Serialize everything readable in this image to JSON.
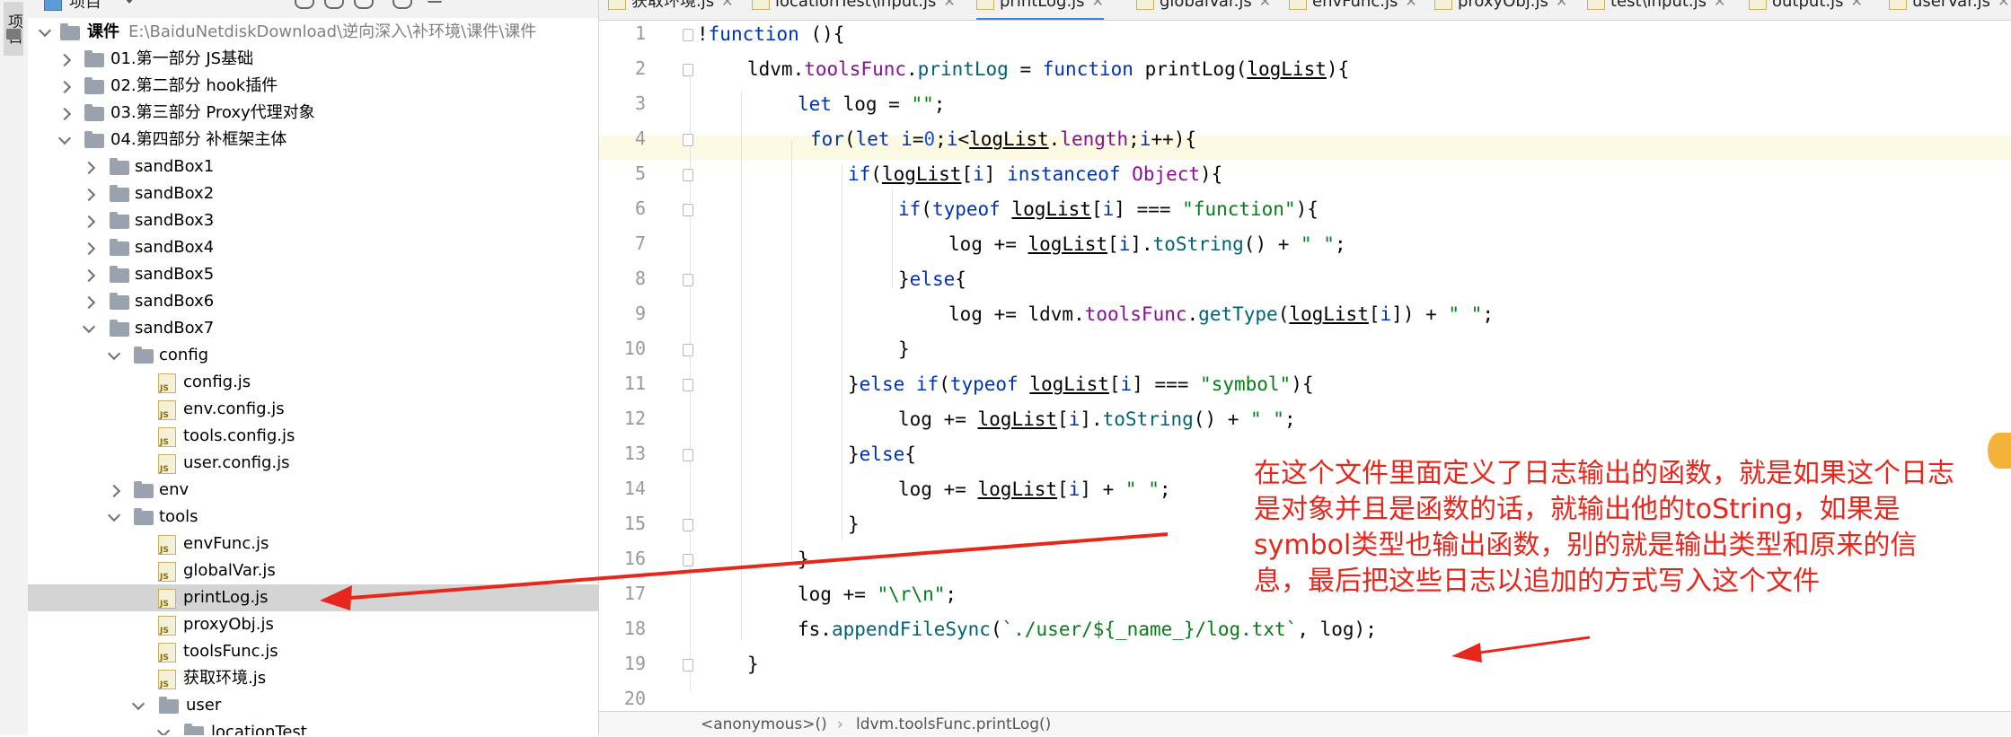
{
  "panel": {
    "title": "项目"
  },
  "tree": {
    "root": {
      "label": "课件",
      "path": "E:\\BaiduNetdiskDownload\\逆向深入\\补环境\\课件\\课件"
    },
    "items": [
      {
        "label": "01.第一部分 JS基础"
      },
      {
        "label": "02.第二部分 hook插件"
      },
      {
        "label": "03.第三部分 Proxy代理对象"
      },
      {
        "label": "04.第四部分 补框架主体"
      },
      {
        "label": "sandBox1"
      },
      {
        "label": "sandBox2"
      },
      {
        "label": "sandBox3"
      },
      {
        "label": "sandBox4"
      },
      {
        "label": "sandBox5"
      },
      {
        "label": "sandBox6"
      },
      {
        "label": "sandBox7"
      },
      {
        "label": "config"
      },
      {
        "label": "config.js"
      },
      {
        "label": "env.config.js"
      },
      {
        "label": "tools.config.js"
      },
      {
        "label": "user.config.js"
      },
      {
        "label": "env"
      },
      {
        "label": "tools"
      },
      {
        "label": "envFunc.js"
      },
      {
        "label": "globalVar.js"
      },
      {
        "label": "printLog.js"
      },
      {
        "label": "proxyObj.js"
      },
      {
        "label": "toolsFunc.js"
      },
      {
        "label": "获取环境.js"
      },
      {
        "label": "user"
      },
      {
        "label": "locationTest"
      }
    ]
  },
  "tabs": [
    {
      "label": "获取环境.js"
    },
    {
      "label": "locationTest\\input.js"
    },
    {
      "label": "printLog.js"
    },
    {
      "label": "globalVar.js"
    },
    {
      "label": "envFunc.js"
    },
    {
      "label": "proxyObj.js"
    },
    {
      "label": "test\\input.js"
    },
    {
      "label": "output.js"
    },
    {
      "label": "userVar.js"
    }
  ],
  "editor": {
    "line_numbers": [
      "1",
      "2",
      "3",
      "4",
      "5",
      "6",
      "7",
      "8",
      "9",
      "10",
      "11",
      "12",
      "13",
      "14",
      "15",
      "16",
      "17",
      "18",
      "19",
      "20"
    ],
    "current_line": 4,
    "lines": [
      "!function (){",
      "ldvm.toolsFunc.printLog = function printLog(logList){",
      "let log = \"\";",
      "for(let i=0;i<logList.length;i++){",
      "if(logList[i] instanceof Object){",
      "if(typeof logList[i] === \"function\"){",
      "log += logList[i].toString() + \" \";",
      "}else{",
      "log += ldvm.toolsFunc.getType(logList[i]) + \" \";",
      "}",
      "}else if(typeof logList[i] === \"symbol\"){",
      "log += logList[i].toString() + \" \";",
      "}else{",
      "log += logList[i] + \" \";",
      "}",
      "}",
      "log += \"\\r\\n\";",
      "fs.appendFileSync(`./user/${_name_}/log.txt`, log);",
      "}",
      ""
    ]
  },
  "breadcrumb": {
    "first": "<anonymous>()",
    "second": "ldvm.toolsFunc.printLog()"
  },
  "annotation": {
    "lines": [
      "在这个文件里面定义了日志输出的函数，就是如果这个日志",
      "是对象并且是函数的话，就输出他的toString，如果是",
      "symbol类型也输出函数，别的就是输出类型和原来的信",
      "息，最后把这些日志以追加的方式写入这个文件"
    ],
    "color": "#e8271c"
  },
  "colors": {
    "keyword": "#0033b3",
    "string": "#067d17",
    "number": "#1750eb",
    "property": "#871094",
    "function": "#00627a"
  }
}
